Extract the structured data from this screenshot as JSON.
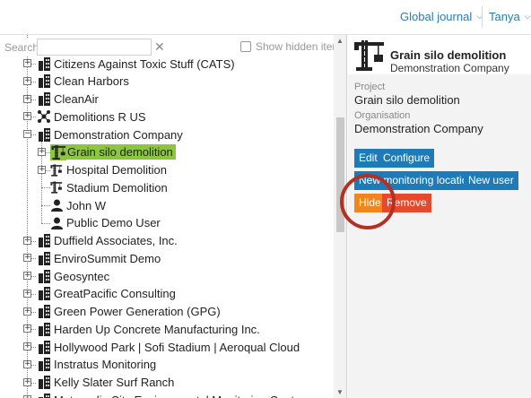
{
  "header": {
    "journal_menu": "Global journal",
    "user_menu": "Tanya"
  },
  "search": {
    "label": "Search",
    "value": "",
    "placeholder": "",
    "show_hidden_label": "Show hidden items",
    "show_hidden_checked": false
  },
  "tree": {
    "nodes": [
      {
        "label": "Citizens Against Toxic Stuff (CATS)",
        "type": "company",
        "toggle": "+"
      },
      {
        "label": "Clean Harbors",
        "type": "company",
        "toggle": "+"
      },
      {
        "label": "CleanAir",
        "type": "company",
        "toggle": "+"
      },
      {
        "label": "Demolitions R US",
        "type": "network",
        "toggle": "+"
      },
      {
        "label": "Demonstration Company",
        "type": "company",
        "toggle": "-"
      },
      {
        "label": "Grain silo demolition",
        "type": "project",
        "toggle": "+",
        "selected": true
      },
      {
        "label": "Hospital Demolition",
        "type": "project",
        "toggle": "+"
      },
      {
        "label": "Stadium Demolition",
        "type": "project",
        "toggle": ""
      },
      {
        "label": "John W",
        "type": "user",
        "toggle": ""
      },
      {
        "label": "Public Demo User",
        "type": "user",
        "toggle": ""
      },
      {
        "label": "Duffield Associates, Inc.",
        "type": "company",
        "toggle": "+"
      },
      {
        "label": "EnviroSummit Demo",
        "type": "company",
        "toggle": "+"
      },
      {
        "label": "Geosyntec",
        "type": "company",
        "toggle": "+"
      },
      {
        "label": "GreatPacific Consulting",
        "type": "company",
        "toggle": "+"
      },
      {
        "label": "Green Power Generation (GPG)",
        "type": "company",
        "toggle": "+"
      },
      {
        "label": "Harden Up Concrete Manufacturing Inc.",
        "type": "company",
        "toggle": "+"
      },
      {
        "label": "Hollywood Park | Sofi Stadium | Aeroqual Cloud",
        "type": "company",
        "toggle": "+"
      },
      {
        "label": "Instratus Monitoring",
        "type": "company",
        "toggle": "+"
      },
      {
        "label": "Kelly Slater Surf Ranch",
        "type": "company",
        "toggle": "+"
      },
      {
        "label": "Metropolis City Environmental Monitoring Center",
        "type": "company",
        "toggle": "+"
      }
    ]
  },
  "detail": {
    "title": "Grain silo demolition",
    "subtitle": "Demonstration Company",
    "project_label": "Project",
    "project_value": "Grain silo demolition",
    "org_label": "Organisation",
    "org_value": "Demonstration Company",
    "buttons": {
      "edit": "Edit",
      "configure": "Configure",
      "new_location": "New monitoring location",
      "new_user": "New user",
      "hide": "Hide",
      "remove": "Remove"
    }
  },
  "colors": {
    "accent": "#1f7ab8",
    "selected": "#8cc63e",
    "hide_button": "#f0861d",
    "remove_button": "#e6492b",
    "annotation_circle": "#b33022"
  }
}
